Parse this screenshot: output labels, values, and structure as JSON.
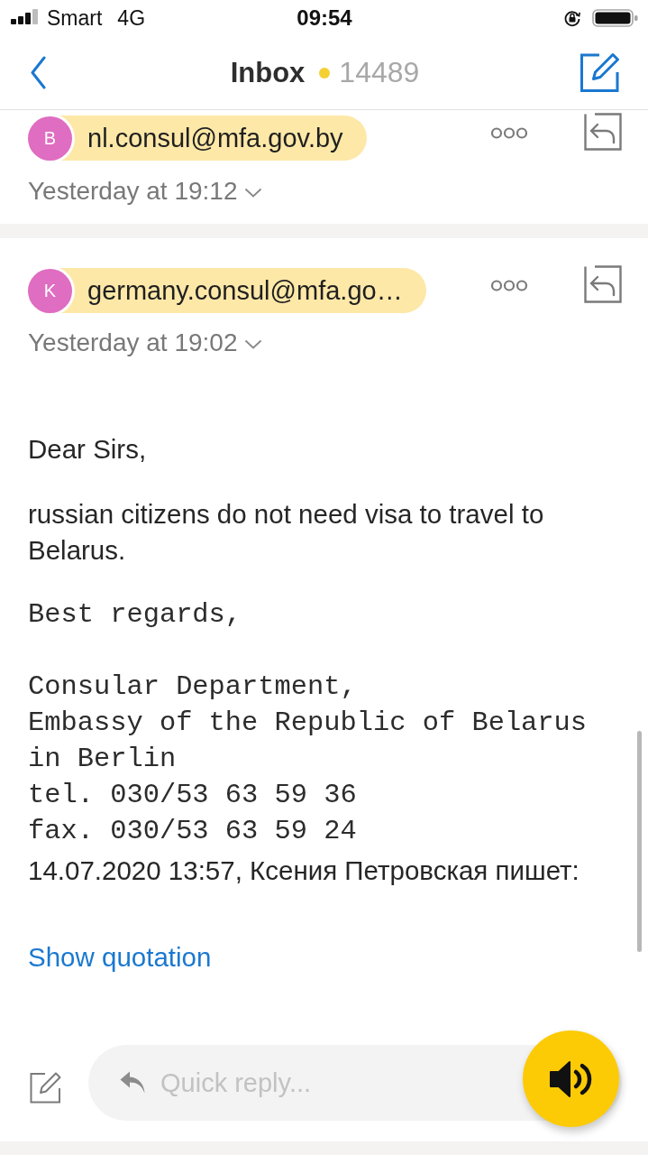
{
  "status_bar": {
    "carrier": "Smart",
    "network": "4G",
    "time": "09:54"
  },
  "nav_bar": {
    "title": "Inbox",
    "unread_count": "14489"
  },
  "messages": [
    {
      "avatar_initial": "B",
      "sender": "nl.consul@mfa.gov.by",
      "date": "Yesterday at 19:12"
    },
    {
      "avatar_initial": "K",
      "sender": "germany.consul@mfa.go…",
      "date": "Yesterday at 19:02",
      "body": [
        {
          "kind": "text",
          "text": "Dear Sirs,"
        },
        {
          "kind": "text",
          "text": "russian citizens do not need visa to travel to Belarus."
        },
        {
          "kind": "mono",
          "lines": [
            "Best regards,"
          ]
        },
        {
          "kind": "mono",
          "lines": [
            "Consular Department,",
            "Embassy of the Republic of Belarus",
            "in Berlin",
            "tel. 030/53 63 59 36",
            "fax. 030/53 63 59 24"
          ]
        },
        {
          "kind": "text",
          "text": "14.07.2020 13:57, Ксения Петровская пишет:"
        },
        {
          "kind": "link",
          "text": "Show quotation"
        }
      ]
    }
  ],
  "quick_reply": {
    "placeholder": "Quick reply..."
  }
}
